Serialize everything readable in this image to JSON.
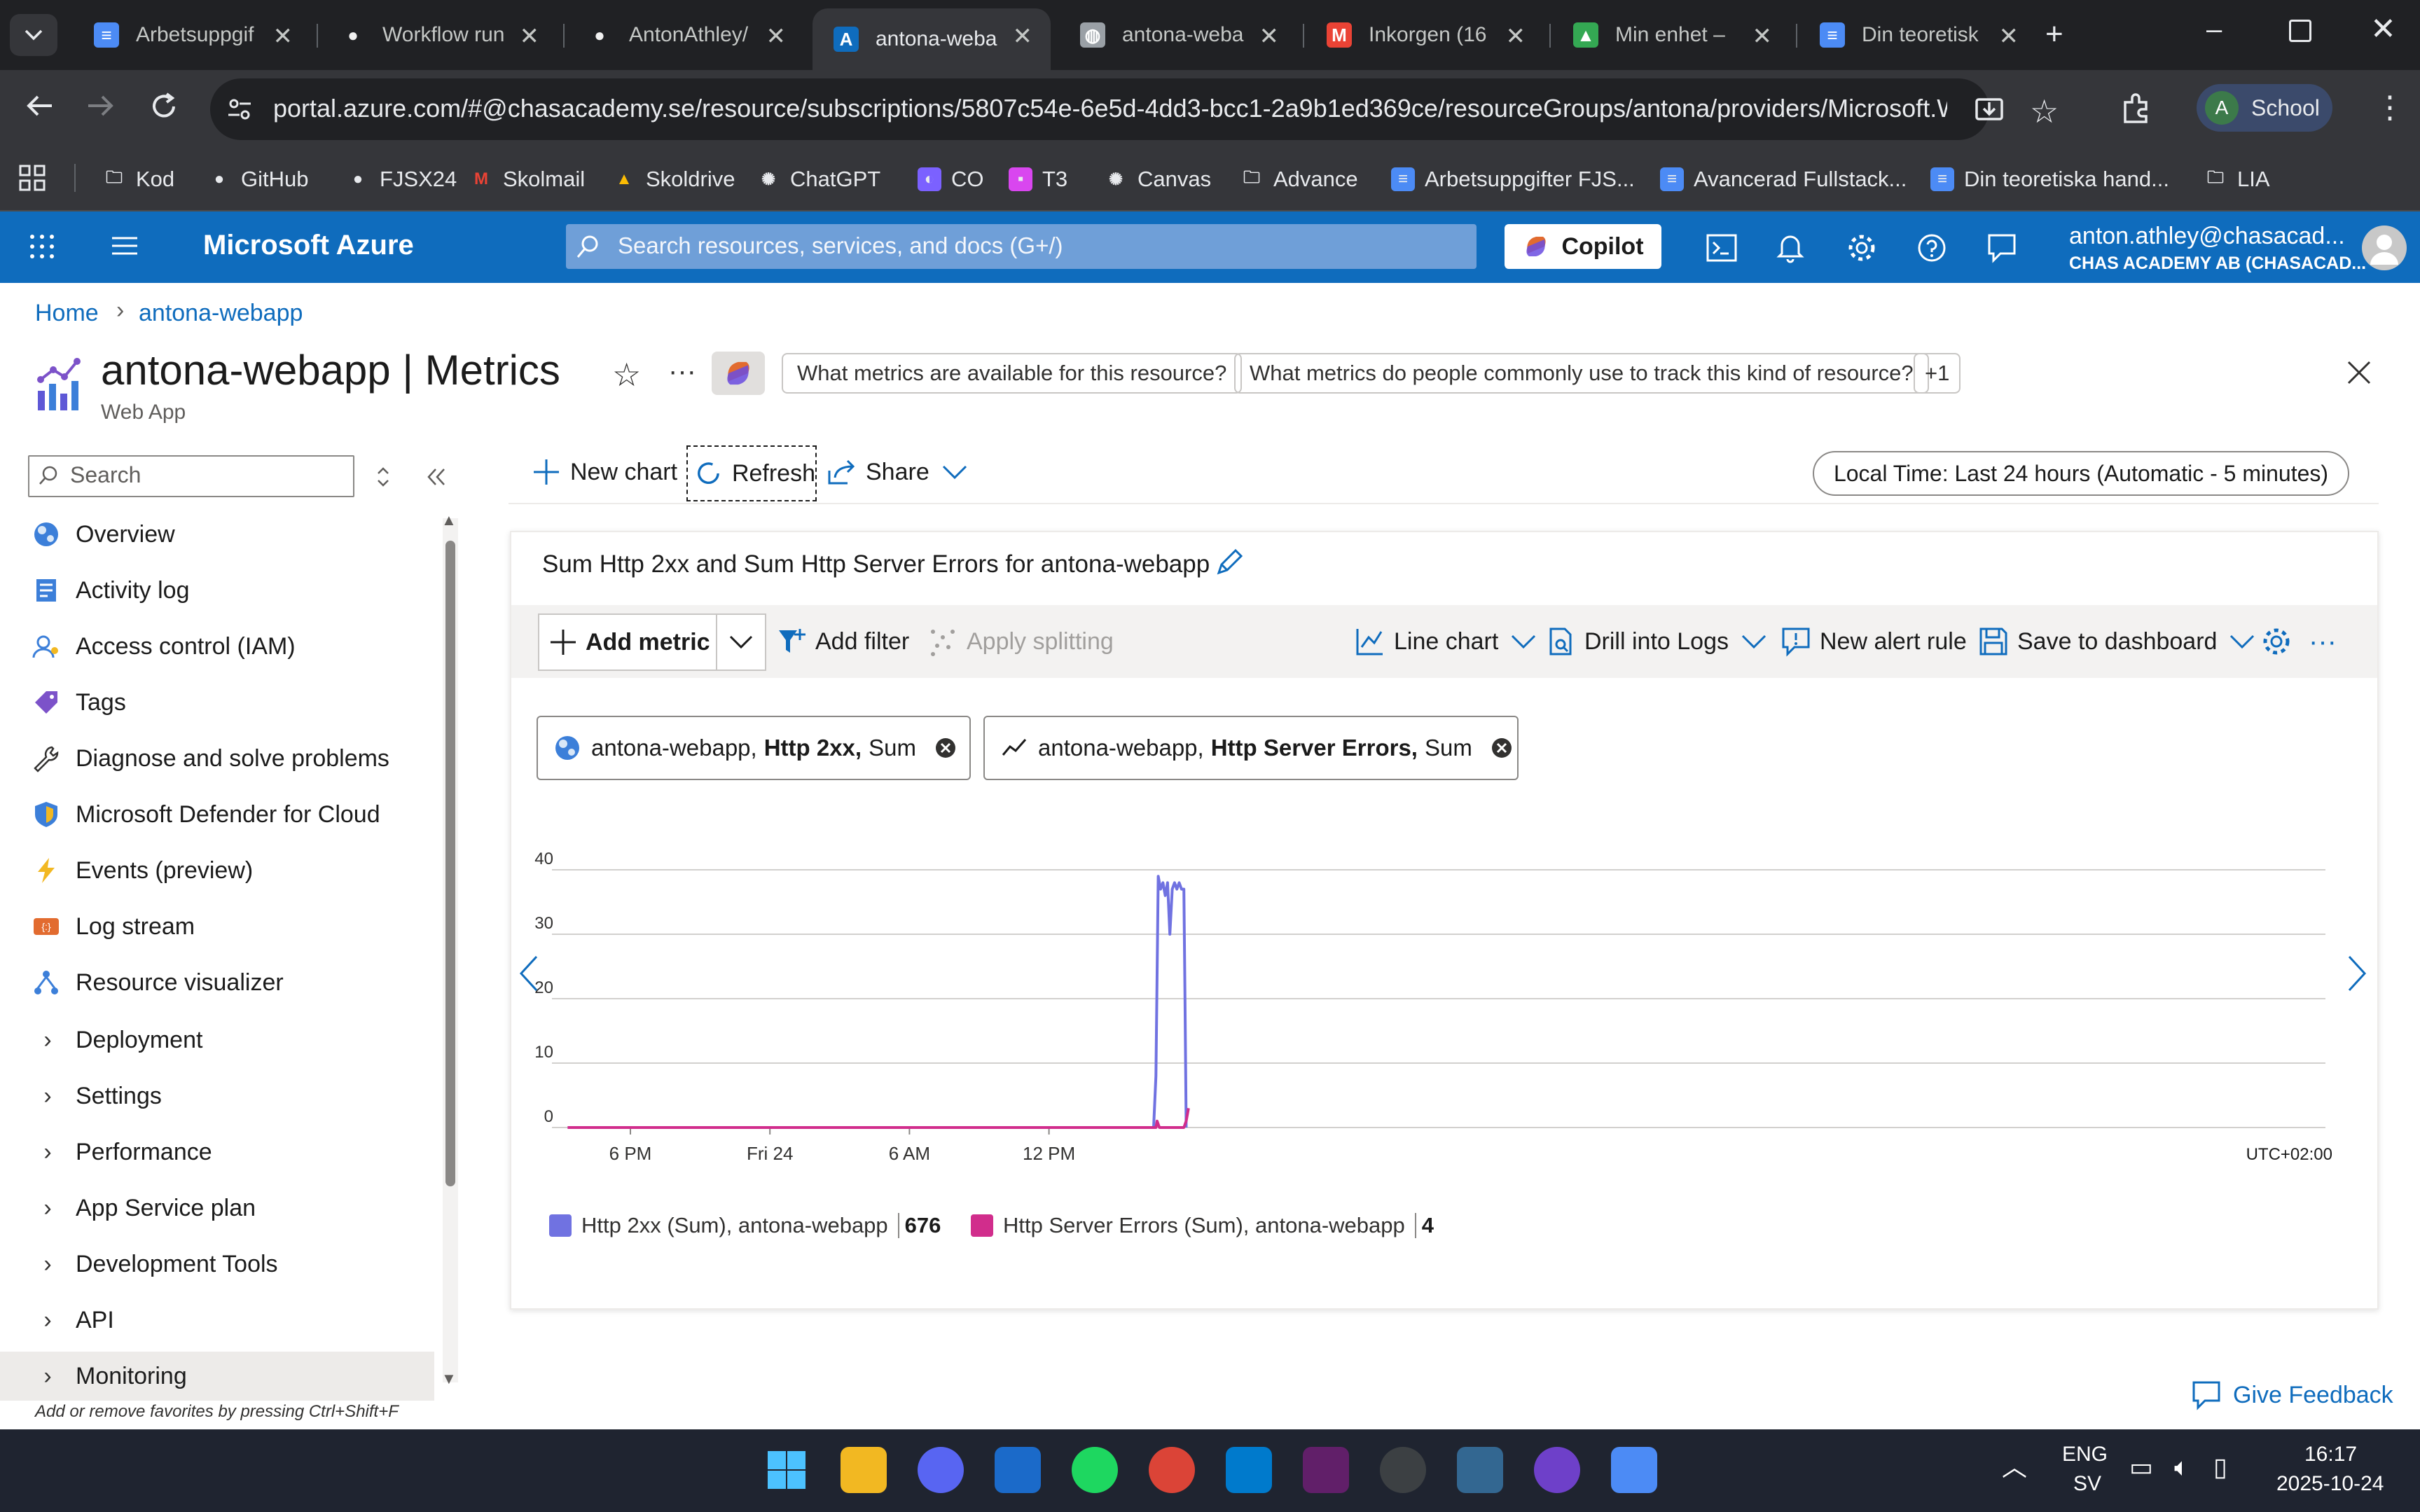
{
  "browser": {
    "tabs": [
      {
        "label": "Arbetsuppgif",
        "icon": "docs-icon"
      },
      {
        "label": "Workflow run",
        "icon": "github-icon"
      },
      {
        "label": "AntonAthley/",
        "icon": "github-icon"
      },
      {
        "label": "antona-weba",
        "icon": "azure-icon",
        "active": true
      },
      {
        "label": "antona-weba",
        "icon": "globe-icon"
      },
      {
        "label": "Inkorgen (16",
        "icon": "gmail-icon"
      },
      {
        "label": "Min enhet – ",
        "icon": "drive-icon"
      },
      {
        "label": "Din teoretisk",
        "icon": "docs-icon"
      }
    ],
    "url": "portal.azure.com/#@chasacademy.se/resource/subscriptions/5807c54e-6e5d-4dd3-bcc1-2a9b1ed369ce/resourceGroups/antona/providers/Microsoft.We...",
    "profile_label": "School",
    "profile_initial": "A",
    "bookmarks": [
      {
        "label": "Kod",
        "icon": "folder-icon"
      },
      {
        "label": "GitHub",
        "icon": "github-icon"
      },
      {
        "label": "FJSX24",
        "icon": "github-icon"
      },
      {
        "label": "Skolmail",
        "icon": "gmail-icon"
      },
      {
        "label": "Skoldrive",
        "icon": "drive-icon"
      },
      {
        "label": "ChatGPT",
        "icon": "chatgpt-icon"
      },
      {
        "label": "CO",
        "icon": "copilot-icon"
      },
      {
        "label": "T3",
        "icon": "chat-icon"
      },
      {
        "label": "Canvas",
        "icon": "canvas-icon"
      },
      {
        "label": "Advance",
        "icon": "folder-icon"
      },
      {
        "label": "Arbetsuppgifter FJS...",
        "icon": "docs-icon"
      },
      {
        "label": "Avancerad Fullstack...",
        "icon": "docs-icon"
      },
      {
        "label": "Din teoretiska hand...",
        "icon": "docs-icon"
      },
      {
        "label": "LIA",
        "icon": "folder-icon"
      }
    ]
  },
  "azure": {
    "brand": "Microsoft Azure",
    "search_placeholder": "Search resources, services, and docs (G+/)",
    "copilot_label": "Copilot",
    "account_email": "anton.athley@chasacad...",
    "account_org": "CHAS ACADEMY AB (CHASACAD..."
  },
  "breadcrumb": [
    "Home",
    "antona-webapp"
  ],
  "page": {
    "title": "antona-webapp | Metrics",
    "subtitle": "Web App",
    "suggestions": [
      "What metrics are available for this resource?",
      "What metrics do people commonly use to track this kind of resource?",
      "+1"
    ]
  },
  "sidebar": {
    "search_placeholder": "Search",
    "items": [
      {
        "label": "Overview",
        "icon": "overview-icon"
      },
      {
        "label": "Activity log",
        "icon": "activity-log-icon"
      },
      {
        "label": "Access control (IAM)",
        "icon": "iam-icon"
      },
      {
        "label": "Tags",
        "icon": "tag-icon"
      },
      {
        "label": "Diagnose and solve problems",
        "icon": "wrench-icon"
      },
      {
        "label": "Microsoft Defender for Cloud",
        "icon": "shield-icon"
      },
      {
        "label": "Events (preview)",
        "icon": "lightning-icon"
      },
      {
        "label": "Log stream",
        "icon": "log-stream-icon"
      },
      {
        "label": "Resource visualizer",
        "icon": "visualizer-icon"
      }
    ],
    "groups": [
      "Deployment",
      "Settings",
      "Performance",
      "App Service plan",
      "Development Tools",
      "API",
      "Monitoring"
    ],
    "footer_hint": "Add or remove favorites by pressing Ctrl+Shift+F"
  },
  "command_bar": {
    "new_chart": "New chart",
    "refresh": "Refresh",
    "share": "Share",
    "time_range": "Local Time: Last 24 hours (Automatic - 5 minutes)"
  },
  "chart_toolbar": {
    "add_metric": "Add metric",
    "add_filter": "Add filter",
    "apply_splitting": "Apply splitting",
    "line_chart": "Line chart",
    "drill_logs": "Drill into Logs",
    "new_alert": "New alert rule",
    "save_dashboard": "Save to dashboard"
  },
  "metric_pills": [
    {
      "resource": "antona-webapp,",
      "metric": "Http 2xx,",
      "agg": "Sum",
      "icon": "webapp-icon"
    },
    {
      "resource": "antona-webapp,",
      "metric": "Http Server Errors,",
      "agg": "Sum",
      "icon": "line-metric-icon"
    }
  ],
  "chart_data": {
    "type": "line",
    "title": "Sum Http 2xx and Sum Http Server Errors for antona-webapp",
    "x_tick_labels": [
      "6 PM",
      "Fri 24",
      "6 AM",
      "12 PM"
    ],
    "x_tick_hours": [
      0,
      6,
      12,
      18
    ],
    "timezone_label": "UTC+02:00",
    "ylim": [
      0,
      40
    ],
    "y_ticks": [
      0,
      10,
      20,
      30,
      40
    ],
    "grid": true,
    "legend_position": "bottom-left",
    "series": [
      {
        "name": "Http 2xx (Sum), antona-webapp",
        "total": "676",
        "color": "#7072e1",
        "x": [
          -2.7,
          22.5,
          22.6,
          22.7,
          22.8,
          22.9,
          23.0,
          23.1,
          23.2,
          23.3,
          23.4,
          23.5,
          23.6,
          23.7,
          23.75,
          23.8,
          23.85,
          23.9
        ],
        "y": [
          0,
          0,
          8,
          39,
          37,
          38,
          36,
          38,
          30,
          37,
          38,
          37,
          38,
          37,
          37,
          37,
          20,
          0
        ]
      },
      {
        "name": "Http Server Errors (Sum), antona-webapp",
        "total": "4",
        "color": "#d12d8c",
        "x": [
          -2.7,
          22.6,
          22.65,
          22.75,
          23.8,
          23.9,
          24.0
        ],
        "y": [
          0,
          0,
          1,
          0,
          0,
          1,
          3
        ]
      }
    ]
  },
  "feedback_label": "Give Feedback",
  "taskbar": {
    "language": "ENG",
    "layout": "SV",
    "time": "16:17",
    "date": "2025-10-24"
  }
}
